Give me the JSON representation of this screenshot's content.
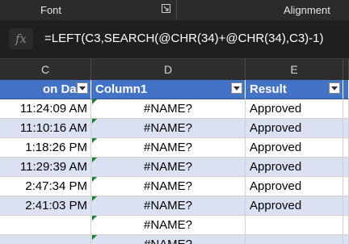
{
  "ribbon": {
    "font_group": "Font",
    "alignment_group": "Alignment"
  },
  "formula_bar": {
    "fx_label": "fx",
    "formula": "=LEFT(C3,SEARCH(@CHR(34)+@CHR(34),C3)-1)"
  },
  "column_headers": [
    "C",
    "D",
    "E"
  ],
  "table": {
    "headers": [
      "on Date",
      "Column1",
      "Result"
    ],
    "rows": [
      {
        "c": "11:24:09 AM",
        "d": "#NAME?",
        "e": "Approved"
      },
      {
        "c": "11:10:16 AM",
        "d": "#NAME?",
        "e": "Approved"
      },
      {
        "c": "1:18:26 PM",
        "d": "#NAME?",
        "e": "Approved"
      },
      {
        "c": "11:29:39 AM",
        "d": "#NAME?",
        "e": "Approved"
      },
      {
        "c": "2:47:34 PM",
        "d": "#NAME?",
        "e": "Approved"
      },
      {
        "c": "2:41:03 PM",
        "d": "#NAME?",
        "e": "Approved"
      },
      {
        "c": "",
        "d": "#NAME?",
        "e": ""
      },
      {
        "c": "",
        "d": "#NAME?",
        "e": ""
      }
    ]
  },
  "colors": {
    "header_blue": "#4472c4",
    "band": "#d9e1f2",
    "error_indicator": "#1a7f2e"
  }
}
